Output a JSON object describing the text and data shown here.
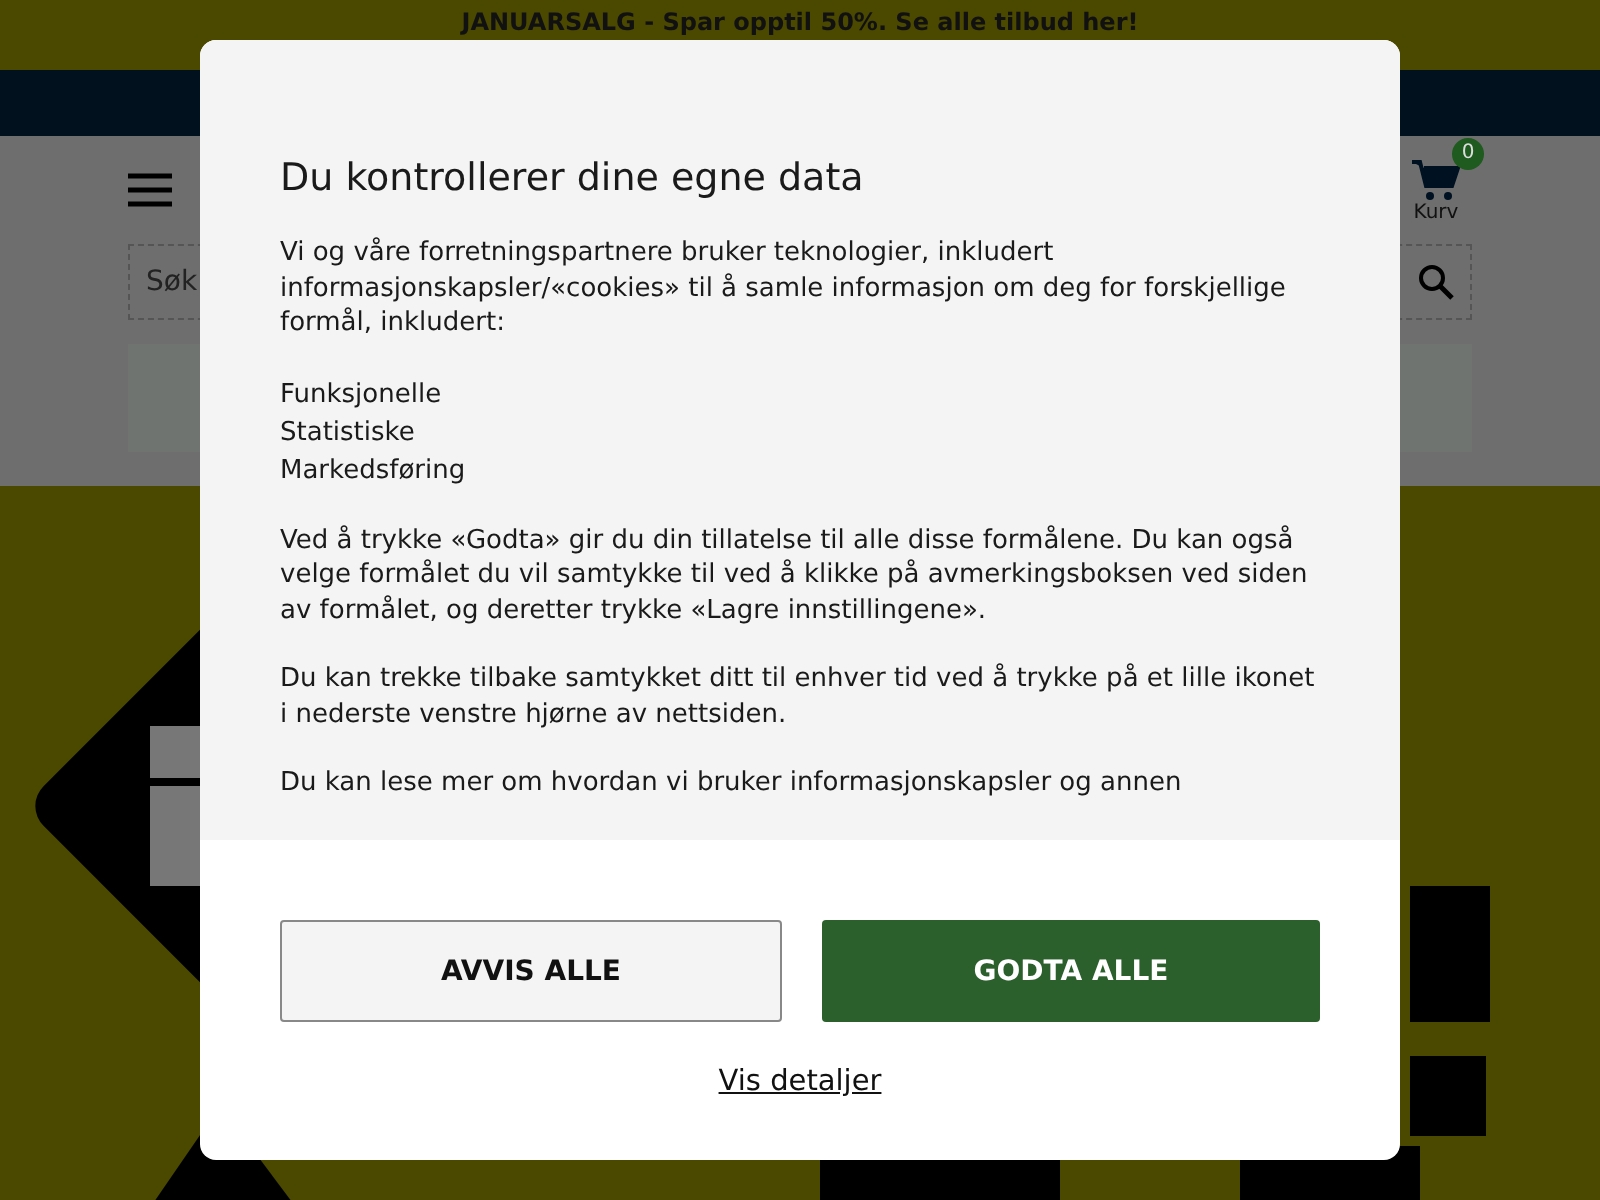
{
  "banner": {
    "text": "JANUARSALG - Spar opptil 50%. Se alle tilbud **her!**"
  },
  "header": {
    "search": {
      "placeholder": "Søk"
    },
    "cart": {
      "count": "0",
      "label": "Kurv"
    }
  },
  "dialog": {
    "title": "Du kontrollerer dine egne data",
    "paragraphs": [
      "Vi og våre forretningspartnere bruker teknologier, inkludert informasjonskapsler/«cookies» til å samle informasjon om deg for forskjellige formål, inkludert:",
      "Ved å trykke «Godta» gir du din tillatelse til alle disse formålene. Du kan også velge formålet du vil samtykke til ved å klikke på avmerkingsboksen ved siden av formålet, og deretter trykke «Lagre innstillingene».",
      "Du kan trekke tilbake samtykket ditt til enhver tid ved å trykke på et lille ikonet i nederste venstre hjørne av nettsiden.",
      "Du kan lese mer om hvordan vi bruker informasjonskapsler og annen"
    ],
    "purposes": [
      "Funksjonelle",
      "Statistiske",
      "Markedsføring"
    ],
    "buttons": [
      {
        "label": "AVVIS ALLE",
        "kind": "secondary"
      },
      {
        "label": "GODTA ALLE",
        "kind": "primary"
      }
    ],
    "details_link": "Vis detaljer"
  }
}
